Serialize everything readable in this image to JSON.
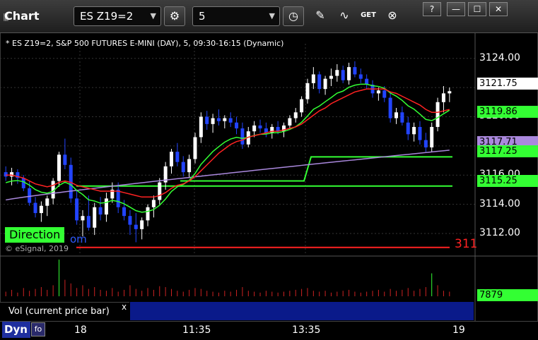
{
  "window": {
    "title": "Chart",
    "symbol": "ES Z19=2",
    "interval": "5",
    "buttons": {
      "help": "?",
      "minimize": "—",
      "maximize": "☐",
      "close": "✕"
    },
    "toolbar_icons": [
      "gear-icon",
      "clock-icon",
      "pencil-icon",
      "study-icon",
      "get-icon",
      "close-circle-icon"
    ]
  },
  "legend": "* ES Z19=2, S&P 500 FUTURES E-MINI (DAY), 5, 09:30-16:15 (Dynamic)",
  "direction_label": "Direction",
  "direction_tail": "om",
  "copyright": "© eSignal, 2019",
  "red_level_text": "311",
  "volume": {
    "label": "Vol (current price bar)",
    "close": "x",
    "value": "7879",
    "value_color": "#33ff33"
  },
  "bottom": {
    "dyn": "Dyn",
    "dyn_btn": "fo",
    "x_labels": [
      "18",
      "11:35",
      "13:35",
      "19"
    ]
  },
  "price_labels": [
    {
      "text": "3121.75",
      "bg": "#ffffff",
      "fg": "#000000",
      "price": 3121.75
    },
    {
      "text": "3119.86",
      "bg": "#33ff33",
      "fg": "#000000",
      "price": 3119.86
    },
    {
      "text": "3117.71",
      "bg": "#aa88dd",
      "fg": "#000000",
      "price": 3117.71
    },
    {
      "text": "3117.25",
      "bg": "#33ff33",
      "fg": "#000000",
      "price": 3117.25
    },
    {
      "text": "3115.25",
      "bg": "#33ff33",
      "fg": "#000000",
      "price": 3115.25
    }
  ],
  "chart_data": {
    "type": "candlestick",
    "title": "* ES Z19=2, S&P 500 FUTURES E-MINI (DAY), 5, 09:30-16:15 (Dynamic)",
    "y_ticks": [
      3124.0,
      3122.0,
      3120.0,
      3118.0,
      3116.0,
      3114.0,
      3112.0
    ],
    "ylim": [
      3110.6,
      3125.0
    ],
    "x_labels": [
      "18",
      "11:35",
      "13:35",
      "19"
    ],
    "grid": true,
    "colors": {
      "up": "#ffffff",
      "down": "#2244ff",
      "ema_red": "#ff2222",
      "ema_green": "#33ff33",
      "vwap": "#aa88dd",
      "line_green": "#33ff33",
      "line_red": "#ff2222"
    },
    "candles": [
      [
        3116.2,
        3116.6,
        3115.6,
        3115.9
      ],
      [
        3115.9,
        3116.5,
        3115.3,
        3116.2
      ],
      [
        3116.2,
        3116.4,
        3115.4,
        3115.8
      ],
      [
        3115.8,
        3116.0,
        3114.9,
        3115.1
      ],
      [
        3115.1,
        3115.6,
        3113.9,
        3114.1
      ],
      [
        3114.1,
        3114.5,
        3113.1,
        3113.4
      ],
      [
        3113.4,
        3114.2,
        3112.8,
        3113.9
      ],
      [
        3113.9,
        3114.6,
        3113.2,
        3114.4
      ],
      [
        3114.4,
        3115.8,
        3114.0,
        3115.6
      ],
      [
        3115.6,
        3117.6,
        3115.2,
        3117.4
      ],
      [
        3117.4,
        3118.5,
        3116.4,
        3116.7
      ],
      [
        3116.7,
        3117.2,
        3114.1,
        3114.4
      ],
      [
        3114.4,
        3114.9,
        3112.6,
        3112.9
      ],
      [
        3112.9,
        3113.6,
        3111.8,
        3113.2
      ],
      [
        3113.2,
        3114.6,
        3112.2,
        3112.4
      ],
      [
        3112.4,
        3114.1,
        3111.9,
        3113.8
      ],
      [
        3113.8,
        3114.5,
        3112.9,
        3113.3
      ],
      [
        3113.3,
        3114.8,
        3112.8,
        3114.4
      ],
      [
        3114.4,
        3115.5,
        3114.1,
        3115.0
      ],
      [
        3115.0,
        3115.5,
        3113.4,
        3113.8
      ],
      [
        3113.8,
        3114.3,
        3112.9,
        3113.2
      ],
      [
        3113.2,
        3113.6,
        3111.9,
        3112.6
      ],
      [
        3112.6,
        3113.4,
        3111.4,
        3112.3
      ],
      [
        3112.3,
        3113.1,
        3111.6,
        3112.9
      ],
      [
        3112.9,
        3114.0,
        3112.5,
        3113.8
      ],
      [
        3113.8,
        3114.6,
        3113.1,
        3114.3
      ],
      [
        3114.3,
        3115.8,
        3114.0,
        3115.5
      ],
      [
        3115.5,
        3116.9,
        3115.0,
        3116.6
      ],
      [
        3116.6,
        3117.8,
        3116.1,
        3117.6
      ],
      [
        3117.6,
        3118.2,
        3116.6,
        3116.9
      ],
      [
        3116.9,
        3117.3,
        3115.9,
        3116.2
      ],
      [
        3116.2,
        3117.4,
        3115.8,
        3117.1
      ],
      [
        3117.1,
        3118.9,
        3116.8,
        3118.6
      ],
      [
        3118.6,
        3120.3,
        3118.2,
        3120.0
      ],
      [
        3120.0,
        3120.4,
        3119.1,
        3119.5
      ],
      [
        3119.5,
        3120.2,
        3118.9,
        3119.9
      ],
      [
        3119.9,
        3120.5,
        3119.4,
        3119.7
      ],
      [
        3119.7,
        3120.1,
        3119.2,
        3119.9
      ],
      [
        3119.9,
        3120.3,
        3119.3,
        3119.6
      ],
      [
        3119.6,
        3120.0,
        3118.8,
        3119.2
      ],
      [
        3119.2,
        3119.6,
        3117.8,
        3118.1
      ],
      [
        3118.1,
        3119.3,
        3117.9,
        3119.0
      ],
      [
        3119.0,
        3119.7,
        3118.6,
        3119.4
      ],
      [
        3119.4,
        3119.8,
        3118.9,
        3119.2
      ],
      [
        3119.2,
        3119.6,
        3118.6,
        3118.9
      ],
      [
        3118.9,
        3119.5,
        3118.5,
        3119.3
      ],
      [
        3119.3,
        3119.7,
        3118.8,
        3119.0
      ],
      [
        3119.0,
        3119.6,
        3118.6,
        3119.4
      ],
      [
        3119.4,
        3120.1,
        3119.1,
        3119.9
      ],
      [
        3119.9,
        3120.6,
        3119.6,
        3120.3
      ],
      [
        3120.3,
        3121.4,
        3120.0,
        3121.2
      ],
      [
        3121.2,
        3122.6,
        3120.9,
        3122.3
      ],
      [
        3122.3,
        3123.4,
        3121.9,
        3122.9
      ],
      [
        3122.9,
        3123.1,
        3121.6,
        3121.9
      ],
      [
        3121.9,
        3122.8,
        3121.5,
        3122.6
      ],
      [
        3122.6,
        3123.3,
        3122.1,
        3122.8
      ],
      [
        3122.8,
        3123.6,
        3122.4,
        3123.2
      ],
      [
        3123.2,
        3123.5,
        3122.3,
        3122.5
      ],
      [
        3122.5,
        3123.7,
        3122.2,
        3123.4
      ],
      [
        3123.4,
        3123.8,
        3122.7,
        3122.9
      ],
      [
        3122.9,
        3123.3,
        3122.3,
        3122.6
      ],
      [
        3122.6,
        3122.9,
        3121.9,
        3122.2
      ],
      [
        3122.2,
        3122.5,
        3121.3,
        3121.6
      ],
      [
        3121.6,
        3122.0,
        3121.1,
        3121.8
      ],
      [
        3121.8,
        3122.1,
        3121.0,
        3121.3
      ],
      [
        3121.3,
        3121.6,
        3119.6,
        3119.9
      ],
      [
        3119.9,
        3120.6,
        3119.5,
        3120.3
      ],
      [
        3120.3,
        3120.7,
        3119.4,
        3119.6
      ],
      [
        3119.6,
        3120.0,
        3118.4,
        3118.8
      ],
      [
        3118.8,
        3119.6,
        3118.3,
        3119.3
      ],
      [
        3119.3,
        3119.7,
        3118.1,
        3118.4
      ],
      [
        3118.4,
        3118.9,
        3117.6,
        3117.9
      ],
      [
        3117.9,
        3119.6,
        3117.6,
        3119.3
      ],
      [
        3119.3,
        3121.3,
        3119.0,
        3121.0
      ],
      [
        3121.0,
        3122.1,
        3120.3,
        3121.6
      ],
      [
        3121.6,
        3122.0,
        3121.0,
        3121.75
      ]
    ],
    "ema_red": [
      3116.0,
      3116.0,
      3115.9,
      3115.8,
      3115.6,
      3115.4,
      3115.3,
      3115.2,
      3115.3,
      3115.5,
      3115.6,
      3115.5,
      3115.3,
      3115.2,
      3115.1,
      3115.0,
      3114.9,
      3114.9,
      3114.9,
      3114.9,
      3114.8,
      3114.7,
      3114.6,
      3114.5,
      3114.5,
      3114.5,
      3114.6,
      3114.8,
      3115.1,
      3115.3,
      3115.4,
      3115.6,
      3115.9,
      3116.3,
      3116.7,
      3117.1,
      3117.5,
      3117.8,
      3118.1,
      3118.3,
      3118.4,
      3118.6,
      3118.7,
      3118.8,
      3118.9,
      3119.0,
      3119.0,
      3119.1,
      3119.2,
      3119.3,
      3119.5,
      3119.8,
      3120.1,
      3120.4,
      3120.6,
      3120.9,
      3121.1,
      3121.3,
      3121.5,
      3121.7,
      3121.8,
      3121.9,
      3121.9,
      3121.9,
      3121.9,
      3121.7,
      3121.6,
      3121.4,
      3121.2,
      3121.0,
      3120.8,
      3120.5,
      3120.3,
      3120.3,
      3120.4,
      3120.5
    ]
  }
}
